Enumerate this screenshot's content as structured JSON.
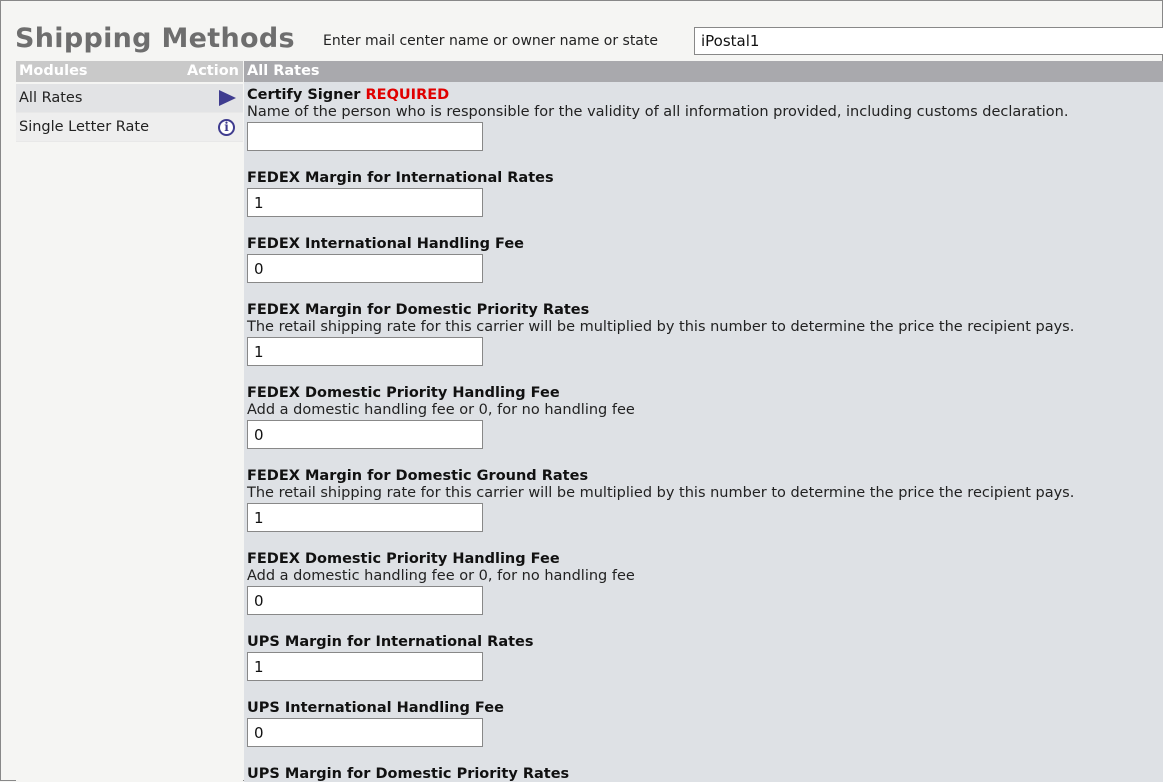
{
  "header": {
    "title": "Shipping Methods",
    "search_label": "Enter mail center name or owner name or state",
    "search_value": "iPostal1"
  },
  "sidebar": {
    "col_modules": "Modules",
    "col_action": "Action",
    "items": [
      {
        "label": "All Rates",
        "icon": "play-icon"
      },
      {
        "label": "Single Letter Rate",
        "icon": "info-icon"
      }
    ]
  },
  "main": {
    "header": "All Rates",
    "fields": [
      {
        "label": "Certify Signer",
        "required": "REQUIRED",
        "desc": "Name of the person who is responsible for the validity of all information provided, including customs declaration.",
        "value": ""
      },
      {
        "label": "FEDEX Margin for International Rates",
        "value": "1"
      },
      {
        "label": "FEDEX International Handling Fee",
        "value": "0"
      },
      {
        "label": "FEDEX Margin for Domestic Priority Rates",
        "desc": "The retail shipping rate for this carrier will be multiplied by this number to determine the price the recipient pays.",
        "value": "1"
      },
      {
        "label": "FEDEX Domestic Priority Handling Fee",
        "desc": "Add a domestic handling fee or 0, for no handling fee",
        "value": "0"
      },
      {
        "label": "FEDEX Margin for Domestic Ground Rates",
        "desc": "The retail shipping rate for this carrier will be multiplied by this number to determine the price the recipient pays.",
        "value": "1"
      },
      {
        "label": "FEDEX Domestic Priority Handling Fee",
        "desc": "Add a domestic handling fee or 0, for no handling fee",
        "value": "0"
      },
      {
        "label": "UPS Margin for International Rates",
        "value": "1"
      },
      {
        "label": "UPS International Handling Fee",
        "value": "0"
      },
      {
        "label": "UPS Margin for Domestic Priority Rates"
      }
    ]
  },
  "colors": {
    "title": "#6e6e6e",
    "required": "#e00000",
    "icon": "#3f3c8f",
    "main_bg": "#dee1e5"
  }
}
